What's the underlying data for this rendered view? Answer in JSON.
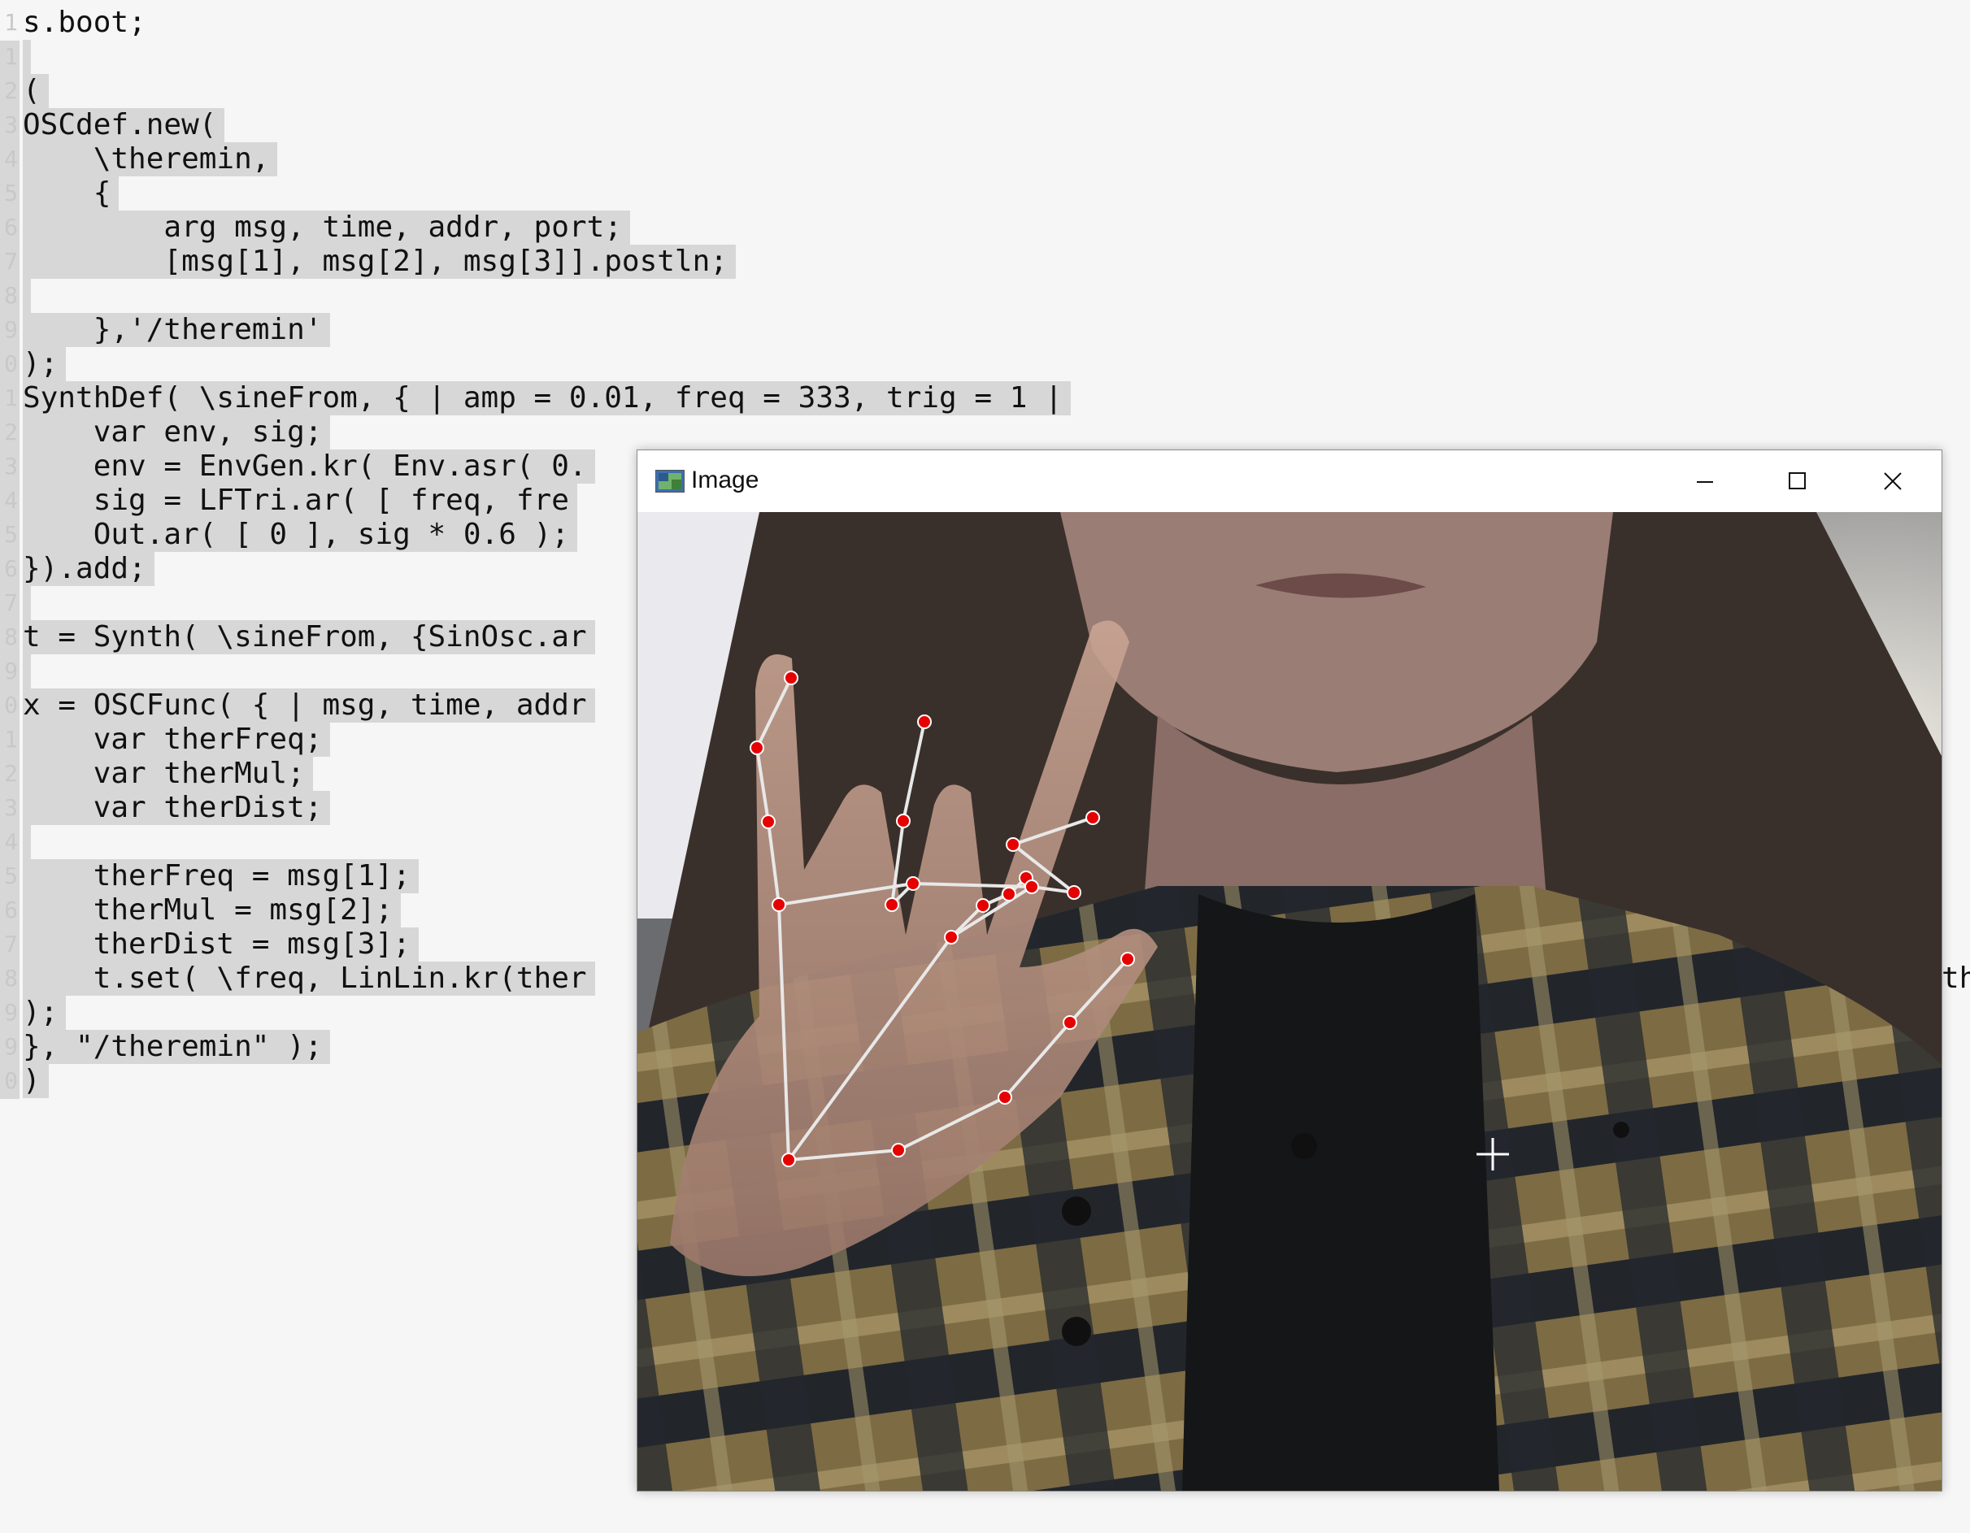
{
  "editor": {
    "lines": [
      {
        "num": "1",
        "text": "s.boot;",
        "selected": false
      },
      {
        "num": "1",
        "text": "",
        "selected": true
      },
      {
        "num": "2",
        "text": "(",
        "selected": true
      },
      {
        "num": "3",
        "text": "OSCdef.new(",
        "selected": true
      },
      {
        "num": "4",
        "text": "    \\theremin,",
        "selected": true
      },
      {
        "num": "5",
        "text": "    {",
        "selected": true
      },
      {
        "num": "6",
        "text": "        arg msg, time, addr, port;",
        "selected": true
      },
      {
        "num": "7",
        "text": "        [msg[1], msg[2], msg[3]].postln;",
        "selected": true
      },
      {
        "num": "8",
        "text": "",
        "selected": true
      },
      {
        "num": "9",
        "text": "    },'/theremin'",
        "selected": true
      },
      {
        "num": "0",
        "text": ");",
        "selected": true
      },
      {
        "num": "1",
        "text": "SynthDef( \\sineFrom, { | amp = 0.01, freq = 333, trig = 1 |",
        "selected": true
      },
      {
        "num": "2",
        "text": "    var env, sig;",
        "selected": true
      },
      {
        "num": "3",
        "text": "    env = EnvGen.kr( Env.asr( 0.",
        "selected": true
      },
      {
        "num": "4",
        "text": "    sig = LFTri.ar( [ freq, fre",
        "selected": true
      },
      {
        "num": "5",
        "text": "    Out.ar( [ 0 ], sig * 0.6 );",
        "selected": true
      },
      {
        "num": "6",
        "text": "}).add;",
        "selected": true
      },
      {
        "num": "7",
        "text": "",
        "selected": true
      },
      {
        "num": "8",
        "text": "t = Synth( \\sineFrom, {SinOsc.ar",
        "selected": true
      },
      {
        "num": "9",
        "text": "",
        "selected": true
      },
      {
        "num": "0",
        "text": "x = OSCFunc( { | msg, time, addr",
        "selected": true
      },
      {
        "num": "1",
        "text": "    var therFreq;",
        "selected": true
      },
      {
        "num": "2",
        "text": "    var therMul;",
        "selected": true
      },
      {
        "num": "3",
        "text": "    var therDist;",
        "selected": true
      },
      {
        "num": "4",
        "text": "",
        "selected": true
      },
      {
        "num": "5",
        "text": "    therFreq = msg[1];",
        "selected": true
      },
      {
        "num": "6",
        "text": "    therMul = msg[2];",
        "selected": true
      },
      {
        "num": "7",
        "text": "    therDist = msg[3];",
        "selected": true
      },
      {
        "num": "8",
        "text": "    t.set( \\freq, LinLin.kr(ther",
        "selected": true
      },
      {
        "num": "9",
        "text": ");",
        "selected": true
      },
      {
        "num": "9",
        "text": "}, \"/theremin\" );",
        "selected": true
      },
      {
        "num": "0",
        "text": ")",
        "selected": true
      }
    ],
    "overflow_text": "th"
  },
  "window": {
    "title": "Image",
    "icon": "image-app-icon",
    "buttons": [
      "minimize-icon",
      "maximize-icon",
      "close-icon"
    ]
  },
  "camera": {
    "content": "webcam frame with hand landmark tracking",
    "colors": {
      "landmark": "#e60000",
      "skeleton": "#e8e8e8",
      "crosshair": "#ffffff"
    }
  }
}
